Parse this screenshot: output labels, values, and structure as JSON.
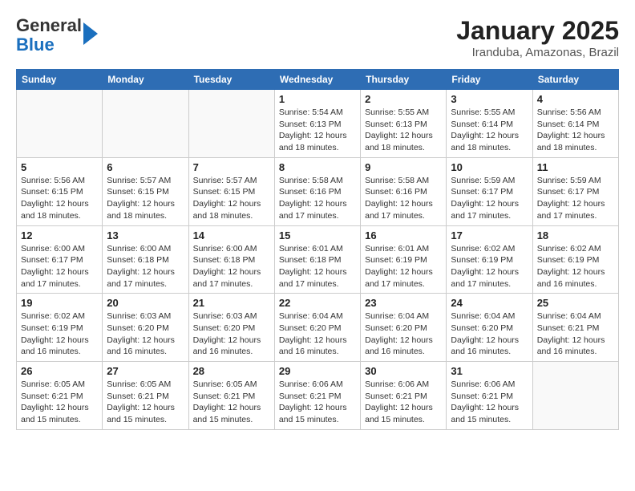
{
  "logo": {
    "general": "General",
    "blue": "Blue"
  },
  "header": {
    "title": "January 2025",
    "location": "Iranduba, Amazonas, Brazil"
  },
  "weekdays": [
    "Sunday",
    "Monday",
    "Tuesday",
    "Wednesday",
    "Thursday",
    "Friday",
    "Saturday"
  ],
  "weeks": [
    [
      {
        "day": "",
        "info": ""
      },
      {
        "day": "",
        "info": ""
      },
      {
        "day": "",
        "info": ""
      },
      {
        "day": "1",
        "info": "Sunrise: 5:54 AM\nSunset: 6:13 PM\nDaylight: 12 hours\nand 18 minutes."
      },
      {
        "day": "2",
        "info": "Sunrise: 5:55 AM\nSunset: 6:13 PM\nDaylight: 12 hours\nand 18 minutes."
      },
      {
        "day": "3",
        "info": "Sunrise: 5:55 AM\nSunset: 6:14 PM\nDaylight: 12 hours\nand 18 minutes."
      },
      {
        "day": "4",
        "info": "Sunrise: 5:56 AM\nSunset: 6:14 PM\nDaylight: 12 hours\nand 18 minutes."
      }
    ],
    [
      {
        "day": "5",
        "info": "Sunrise: 5:56 AM\nSunset: 6:15 PM\nDaylight: 12 hours\nand 18 minutes."
      },
      {
        "day": "6",
        "info": "Sunrise: 5:57 AM\nSunset: 6:15 PM\nDaylight: 12 hours\nand 18 minutes."
      },
      {
        "day": "7",
        "info": "Sunrise: 5:57 AM\nSunset: 6:15 PM\nDaylight: 12 hours\nand 18 minutes."
      },
      {
        "day": "8",
        "info": "Sunrise: 5:58 AM\nSunset: 6:16 PM\nDaylight: 12 hours\nand 17 minutes."
      },
      {
        "day": "9",
        "info": "Sunrise: 5:58 AM\nSunset: 6:16 PM\nDaylight: 12 hours\nand 17 minutes."
      },
      {
        "day": "10",
        "info": "Sunrise: 5:59 AM\nSunset: 6:17 PM\nDaylight: 12 hours\nand 17 minutes."
      },
      {
        "day": "11",
        "info": "Sunrise: 5:59 AM\nSunset: 6:17 PM\nDaylight: 12 hours\nand 17 minutes."
      }
    ],
    [
      {
        "day": "12",
        "info": "Sunrise: 6:00 AM\nSunset: 6:17 PM\nDaylight: 12 hours\nand 17 minutes."
      },
      {
        "day": "13",
        "info": "Sunrise: 6:00 AM\nSunset: 6:18 PM\nDaylight: 12 hours\nand 17 minutes."
      },
      {
        "day": "14",
        "info": "Sunrise: 6:00 AM\nSunset: 6:18 PM\nDaylight: 12 hours\nand 17 minutes."
      },
      {
        "day": "15",
        "info": "Sunrise: 6:01 AM\nSunset: 6:18 PM\nDaylight: 12 hours\nand 17 minutes."
      },
      {
        "day": "16",
        "info": "Sunrise: 6:01 AM\nSunset: 6:19 PM\nDaylight: 12 hours\nand 17 minutes."
      },
      {
        "day": "17",
        "info": "Sunrise: 6:02 AM\nSunset: 6:19 PM\nDaylight: 12 hours\nand 17 minutes."
      },
      {
        "day": "18",
        "info": "Sunrise: 6:02 AM\nSunset: 6:19 PM\nDaylight: 12 hours\nand 16 minutes."
      }
    ],
    [
      {
        "day": "19",
        "info": "Sunrise: 6:02 AM\nSunset: 6:19 PM\nDaylight: 12 hours\nand 16 minutes."
      },
      {
        "day": "20",
        "info": "Sunrise: 6:03 AM\nSunset: 6:20 PM\nDaylight: 12 hours\nand 16 minutes."
      },
      {
        "day": "21",
        "info": "Sunrise: 6:03 AM\nSunset: 6:20 PM\nDaylight: 12 hours\nand 16 minutes."
      },
      {
        "day": "22",
        "info": "Sunrise: 6:04 AM\nSunset: 6:20 PM\nDaylight: 12 hours\nand 16 minutes."
      },
      {
        "day": "23",
        "info": "Sunrise: 6:04 AM\nSunset: 6:20 PM\nDaylight: 12 hours\nand 16 minutes."
      },
      {
        "day": "24",
        "info": "Sunrise: 6:04 AM\nSunset: 6:20 PM\nDaylight: 12 hours\nand 16 minutes."
      },
      {
        "day": "25",
        "info": "Sunrise: 6:04 AM\nSunset: 6:21 PM\nDaylight: 12 hours\nand 16 minutes."
      }
    ],
    [
      {
        "day": "26",
        "info": "Sunrise: 6:05 AM\nSunset: 6:21 PM\nDaylight: 12 hours\nand 15 minutes."
      },
      {
        "day": "27",
        "info": "Sunrise: 6:05 AM\nSunset: 6:21 PM\nDaylight: 12 hours\nand 15 minutes."
      },
      {
        "day": "28",
        "info": "Sunrise: 6:05 AM\nSunset: 6:21 PM\nDaylight: 12 hours\nand 15 minutes."
      },
      {
        "day": "29",
        "info": "Sunrise: 6:06 AM\nSunset: 6:21 PM\nDaylight: 12 hours\nand 15 minutes."
      },
      {
        "day": "30",
        "info": "Sunrise: 6:06 AM\nSunset: 6:21 PM\nDaylight: 12 hours\nand 15 minutes."
      },
      {
        "day": "31",
        "info": "Sunrise: 6:06 AM\nSunset: 6:21 PM\nDaylight: 12 hours\nand 15 minutes."
      },
      {
        "day": "",
        "info": ""
      }
    ]
  ]
}
